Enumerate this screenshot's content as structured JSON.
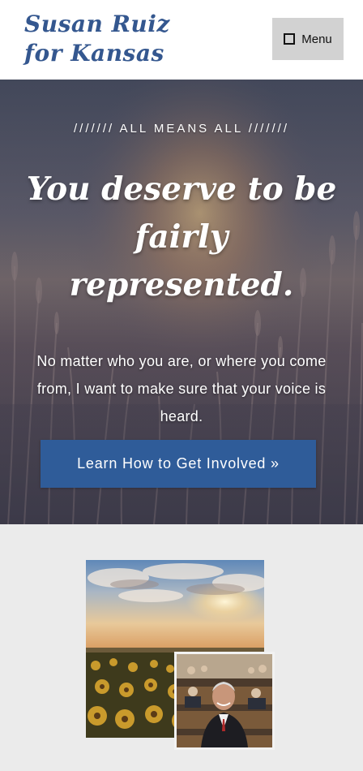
{
  "header": {
    "logo_line1": "Susan Ruiz",
    "logo_line2": "for Kansas",
    "menu_label": "Menu"
  },
  "hero": {
    "eyebrow": "/////// ALL MEANS ALL ///////",
    "headline": "You deserve to be fairly represented.",
    "body": "No matter who you are, or where you come from, I want to make sure that your voice is heard.",
    "cta_label": "Learn How to Get Involved »"
  },
  "colors": {
    "brand_blue": "#34578f",
    "cta_blue": "#2f5c99",
    "section_bg": "#ebebeb"
  }
}
